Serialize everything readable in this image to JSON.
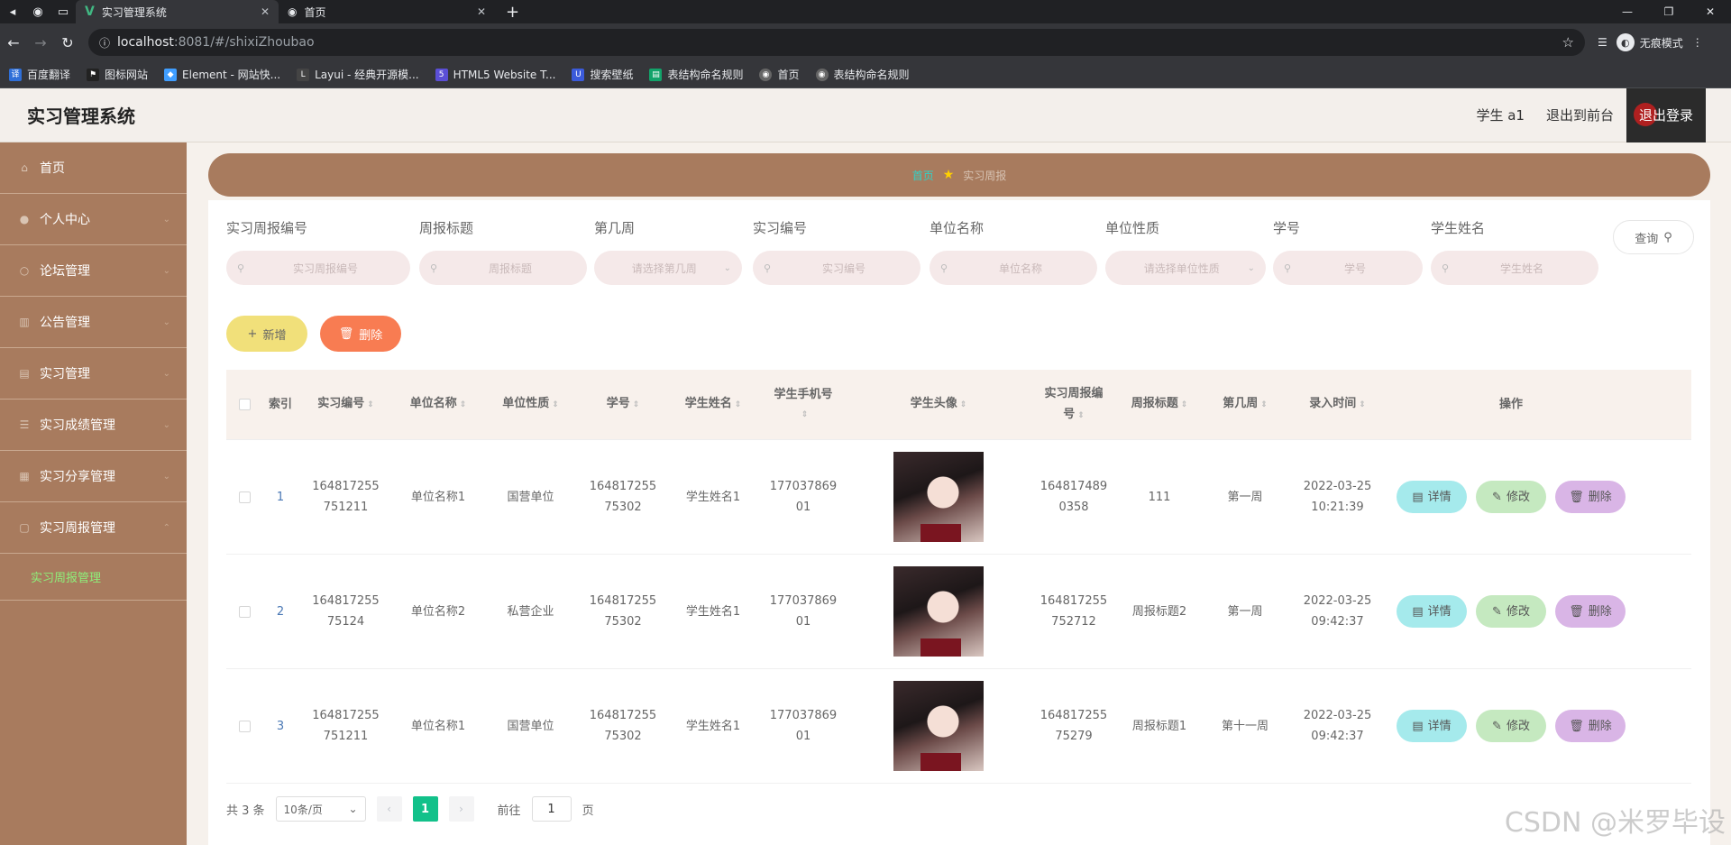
{
  "browser": {
    "tabs": [
      {
        "title": "实习管理系统",
        "active": true
      },
      {
        "title": "首页",
        "active": false
      }
    ],
    "url_host": "localhost",
    "url_path": ":8081/#/shixiZhoubao",
    "incognito_label": "无痕模式",
    "bookmarks": [
      "百度翻译",
      "图标网站",
      "Element - 网站快...",
      "Layui - 经典开源模...",
      "HTML5 Website T...",
      "搜索壁纸",
      "表结构命名规则",
      "首页",
      "表结构命名规则"
    ]
  },
  "header": {
    "title": "实习管理系统",
    "user": "学生 a1",
    "back_to_front": "退出到前台",
    "logout": "退出登录"
  },
  "sidebar": {
    "items": [
      {
        "label": "首页",
        "icon": "home-icon"
      },
      {
        "label": "个人中心",
        "icon": "user-icon"
      },
      {
        "label": "论坛管理",
        "icon": "forum-icon"
      },
      {
        "label": "公告管理",
        "icon": "notice-icon"
      },
      {
        "label": "实习管理",
        "icon": "doc-icon"
      },
      {
        "label": "实习成绩管理",
        "icon": "list-icon"
      },
      {
        "label": "实习分享管理",
        "icon": "grid-icon"
      },
      {
        "label": "实习周报管理",
        "icon": "report-icon"
      }
    ],
    "active_sub": "实习周报管理"
  },
  "breadcrumb": {
    "home": "首页",
    "current": "实习周报"
  },
  "search": {
    "fields": [
      {
        "label": "实习周报编号",
        "placeholder": "实习周报编号",
        "type": "input"
      },
      {
        "label": "周报标题",
        "placeholder": "周报标题",
        "type": "input"
      },
      {
        "label": "第几周",
        "placeholder": "请选择第几周",
        "type": "select"
      },
      {
        "label": "实习编号",
        "placeholder": "实习编号",
        "type": "input"
      },
      {
        "label": "单位名称",
        "placeholder": "单位名称",
        "type": "input"
      },
      {
        "label": "单位性质",
        "placeholder": "请选择单位性质",
        "type": "select"
      },
      {
        "label": "学号",
        "placeholder": "学号",
        "type": "input"
      },
      {
        "label": "学生姓名",
        "placeholder": "学生姓名",
        "type": "input"
      }
    ],
    "query_label": "查询"
  },
  "actions": {
    "add_label": "新增",
    "delete_label": "删除"
  },
  "table": {
    "headers": {
      "index": "索引",
      "code": "实习编号",
      "unit": "单位名称",
      "nature": "单位性质",
      "sno": "学号",
      "sname": "学生姓名",
      "phone_1": "学生手机号",
      "avatar": "学生头像",
      "wcode_1": "实习周报编",
      "wcode_2": "号",
      "wtitle": "周报标题",
      "week": "第几周",
      "time": "录入时间",
      "ops": "操作"
    },
    "rows": [
      {
        "index": "1",
        "code_1": "164817255",
        "code_2": "751211",
        "unit": "单位名称1",
        "nature": "国营单位",
        "sno_1": "164817255",
        "sno_2": "75302",
        "sname": "学生姓名1",
        "phone_1": "177037869",
        "phone_2": "01",
        "wcode_1": "164817489",
        "wcode_2": "0358",
        "wtitle": "111",
        "week": "第一周",
        "time_1": "2022-03-25",
        "time_2": "10:21:39"
      },
      {
        "index": "2",
        "code_1": "164817255",
        "code_2": "75124",
        "unit": "单位名称2",
        "nature": "私营企业",
        "sno_1": "164817255",
        "sno_2": "75302",
        "sname": "学生姓名1",
        "phone_1": "177037869",
        "phone_2": "01",
        "wcode_1": "164817255",
        "wcode_2": "752712",
        "wtitle": "周报标题2",
        "week": "第一周",
        "time_1": "2022-03-25",
        "time_2": "09:42:37"
      },
      {
        "index": "3",
        "code_1": "164817255",
        "code_2": "751211",
        "unit": "单位名称1",
        "nature": "国营单位",
        "sno_1": "164817255",
        "sno_2": "75302",
        "sname": "学生姓名1",
        "phone_1": "177037869",
        "phone_2": "01",
        "wcode_1": "164817255",
        "wcode_2": "75279",
        "wtitle": "周报标题1",
        "week": "第十一周",
        "time_1": "2022-03-25",
        "time_2": "09:42:37"
      }
    ],
    "op_labels": {
      "detail": "详情",
      "edit": "修改",
      "delete": "删除"
    }
  },
  "pagination": {
    "total": "共 3 条",
    "page_size": "10条/页",
    "current_page": "1",
    "goto_label": "前往",
    "goto_value": "1",
    "page_unit": "页"
  },
  "watermark": "CSDN @米罗毕设",
  "colors": {
    "sidebar": "#a87b5e",
    "accent_green": "#12c18a",
    "add_button": "#f1e07a",
    "delete_button": "#f87c52"
  }
}
